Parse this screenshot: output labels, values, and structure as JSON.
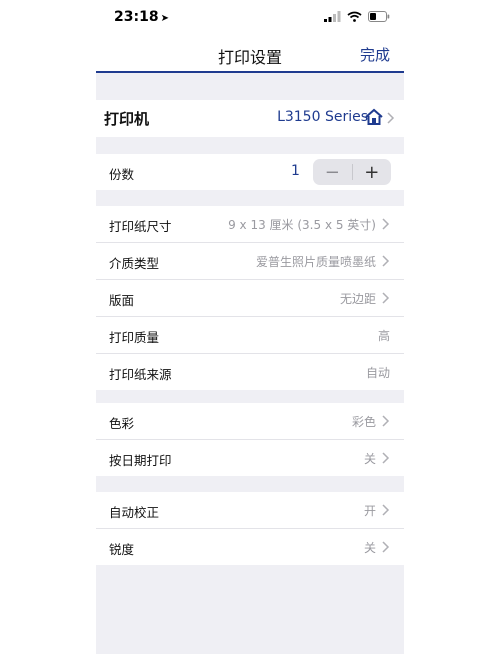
{
  "status_bar": {
    "time": "23:18"
  },
  "nav": {
    "title": "打印设置",
    "done_label": "完成"
  },
  "printer": {
    "label": "打印机",
    "value": "L3150 Series"
  },
  "copies": {
    "label": "份数",
    "value": "1",
    "minus": "−",
    "plus": "+"
  },
  "paper_rows": [
    {
      "label": "打印纸尺寸",
      "value": "9 x 13 厘米 (3.5 x 5 英寸)"
    },
    {
      "label": "介质类型",
      "value": "爱普生照片质量喷墨纸"
    },
    {
      "label": "版面",
      "value": "无边距"
    },
    {
      "label": "打印质量",
      "value": "高"
    },
    {
      "label": "打印纸来源",
      "value": "自动"
    }
  ],
  "color_rows": [
    {
      "label": "色彩",
      "value": "彩色"
    },
    {
      "label": "按日期打印",
      "value": "关"
    }
  ],
  "misc_rows": [
    {
      "label": "自动校正",
      "value": "开"
    },
    {
      "label": "锐度",
      "value": "关"
    }
  ],
  "colors": {
    "accent": "#1f3b8f",
    "background": "#efeff4",
    "secondary_text": "#9a9aa0"
  }
}
